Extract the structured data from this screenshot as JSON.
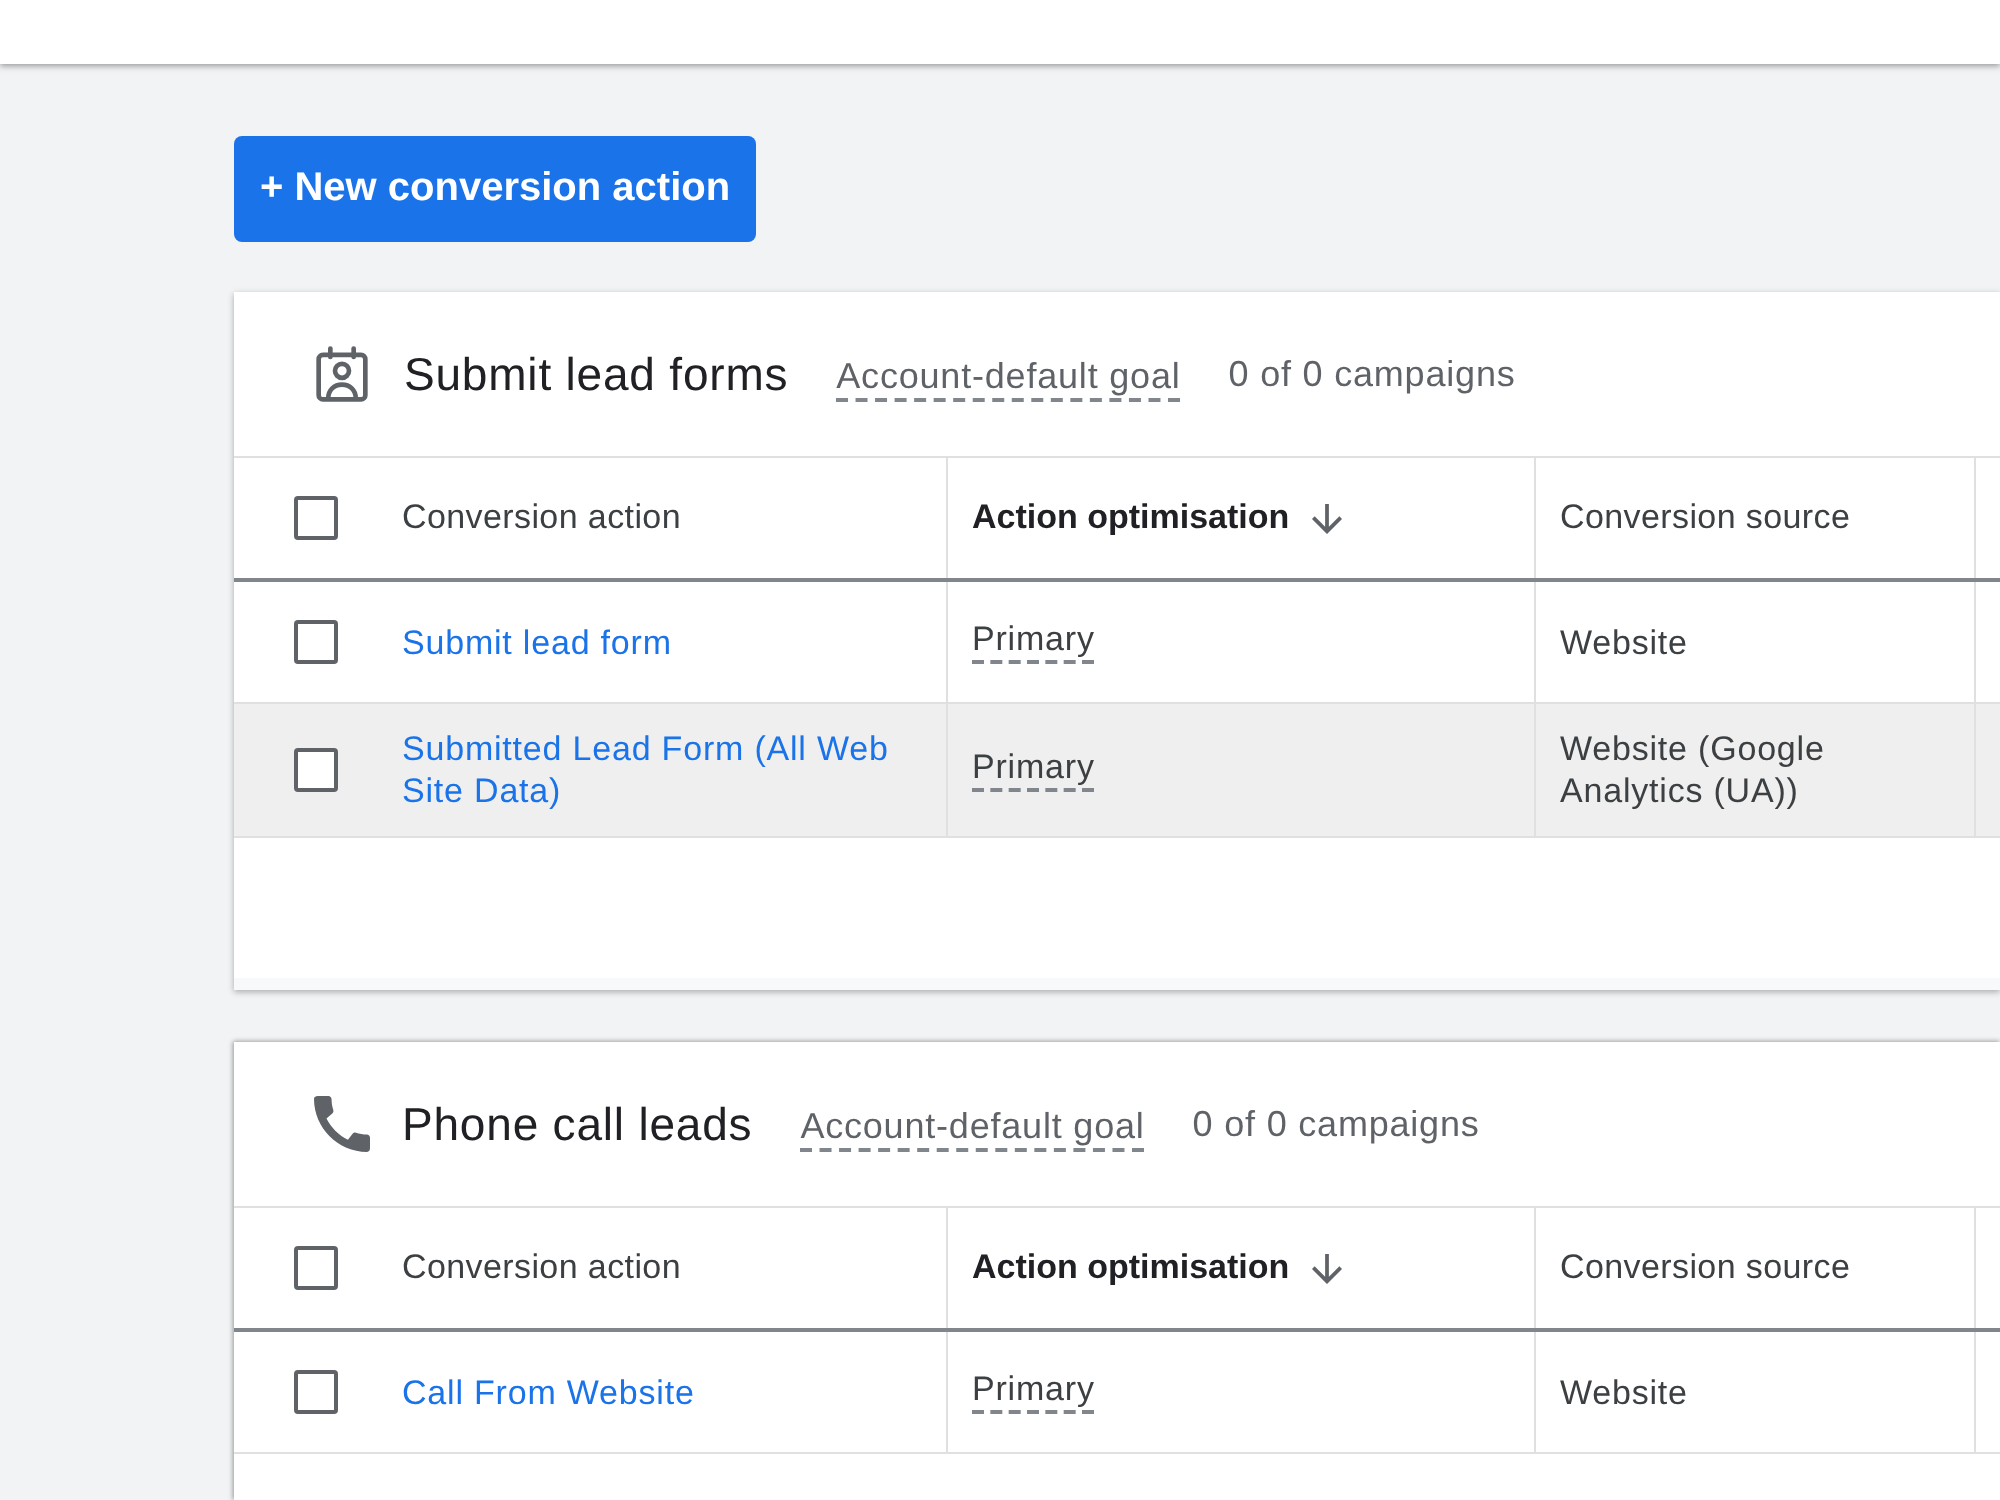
{
  "new_action_button": {
    "label": "+ New conversion action"
  },
  "goals": [
    {
      "kind": "lead_form",
      "title": "Submit lead forms",
      "goal_type": "Account-default goal",
      "campaigns": "0 of 0 campaigns",
      "table": {
        "select_all": {
          "checked": false
        },
        "columns": [
          {
            "label": "Conversion action",
            "sorted": false
          },
          {
            "label": "Action optimisation",
            "sorted": true
          },
          {
            "label": "Conversion source",
            "sorted": false
          }
        ],
        "rows": [
          {
            "checked": false,
            "highlighted": false,
            "conversion_action": "Submit lead form",
            "action_optimisation": "Primary",
            "conversion_source": "Website"
          },
          {
            "checked": false,
            "highlighted": true,
            "conversion_action": "Submitted Lead Form (All Web Site Data)",
            "action_optimisation": "Primary",
            "conversion_source": "Website (Google Analytics (UA))"
          }
        ]
      }
    },
    {
      "kind": "phone_call",
      "title": "Phone call leads",
      "goal_type": "Account-default goal",
      "campaigns": "0 of 0 campaigns",
      "table": {
        "select_all": {
          "checked": false
        },
        "columns": [
          {
            "label": "Conversion action",
            "sorted": false
          },
          {
            "label": "Action optimisation",
            "sorted": true
          },
          {
            "label": "Conversion source",
            "sorted": false
          }
        ],
        "rows": [
          {
            "checked": false,
            "highlighted": false,
            "conversion_action": "Call From Website",
            "action_optimisation": "Primary",
            "conversion_source": "Website"
          }
        ]
      }
    }
  ]
}
